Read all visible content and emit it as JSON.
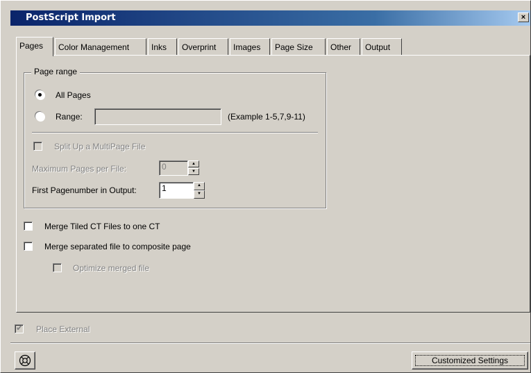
{
  "window": {
    "title": "PostScript Import",
    "close_label": "×"
  },
  "tabs": [
    {
      "label": "Pages"
    },
    {
      "label": "Color Management"
    },
    {
      "label": "Inks"
    },
    {
      "label": "Overprint"
    },
    {
      "label": "Images"
    },
    {
      "label": "Page Size"
    },
    {
      "label": "Other"
    },
    {
      "label": "Output"
    }
  ],
  "page_range": {
    "group_label": "Page range",
    "all_pages_label": "All Pages",
    "range_label": "Range:",
    "range_value": "",
    "range_example": "(Example 1-5,7,9-11)",
    "selected": "All Pages"
  },
  "split": {
    "label": "Split Up a MultiPage File",
    "checked": false,
    "max_pages_label": "Maximum Pages per File:",
    "max_pages_value": "0",
    "first_page_label": "First Pagenumber in Output:",
    "first_page_value": "1"
  },
  "options": {
    "merge_tiled_label": "Merge Tiled CT Files to one CT",
    "merge_separated_label": "Merge separated file to composite page",
    "optimize_label": "Optimize merged file"
  },
  "place_external": {
    "label": "Place External",
    "checked": true
  },
  "footer": {
    "customized_label": "Customized Settings"
  }
}
